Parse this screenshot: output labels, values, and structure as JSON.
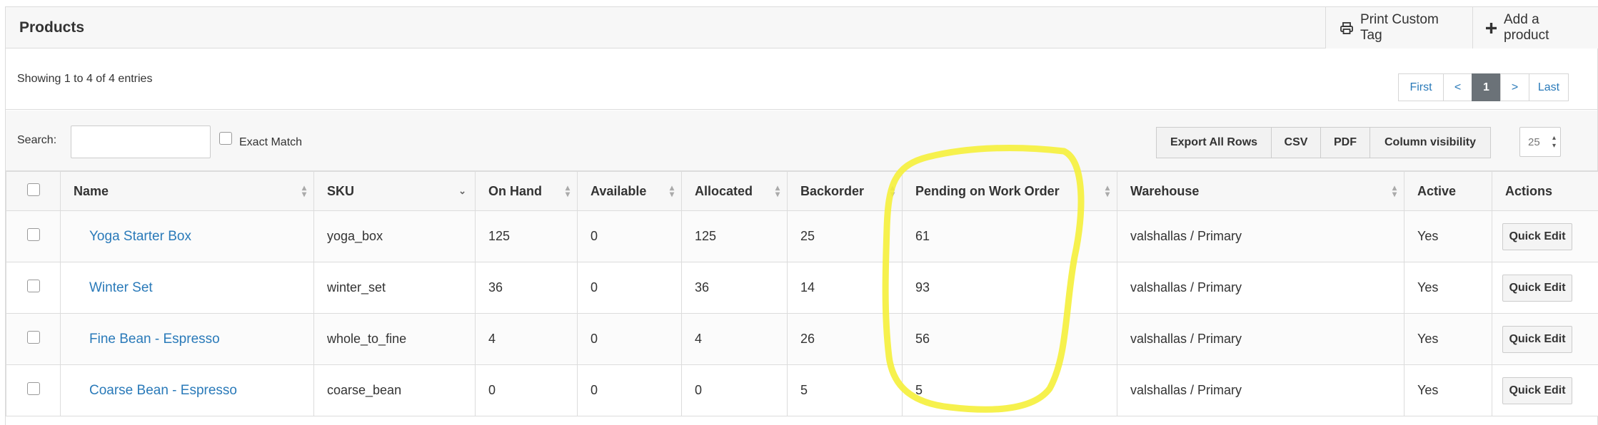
{
  "header": {
    "title": "Products",
    "print_label": "Print Custom Tag",
    "add_label": "Add a product"
  },
  "info": {
    "showing": "Showing 1 to 4 of 4 entries"
  },
  "pager": {
    "first": "First",
    "prev": "<",
    "current": "1",
    "next": ">",
    "last": "Last"
  },
  "tools": {
    "search_label": "Search:",
    "search_value": "",
    "exact_match": "Exact Match",
    "export_all": "Export All Rows",
    "csv": "CSV",
    "pdf": "PDF",
    "column_visibility": "Column visibility",
    "page_length": "25"
  },
  "table": {
    "columns": [
      "Name",
      "SKU",
      "On Hand",
      "Available",
      "Allocated",
      "Backorder",
      "Pending on Work Order",
      "Warehouse",
      "Active",
      "Actions"
    ],
    "rows": [
      {
        "name": "Yoga Starter Box",
        "sku": "yoga_box",
        "on_hand": "125",
        "available": "0",
        "allocated": "125",
        "backorder": "25",
        "pending": "61",
        "warehouse": "valshallas / Primary",
        "active": "Yes",
        "action": "Quick Edit"
      },
      {
        "name": "Winter Set",
        "sku": "winter_set",
        "on_hand": "36",
        "available": "0",
        "allocated": "36",
        "backorder": "14",
        "pending": "93",
        "warehouse": "valshallas / Primary",
        "active": "Yes",
        "action": "Quick Edit"
      },
      {
        "name": "Fine Bean - Espresso",
        "sku": "whole_to_fine",
        "on_hand": "4",
        "available": "0",
        "allocated": "4",
        "backorder": "26",
        "pending": "56",
        "warehouse": "valshallas / Primary",
        "active": "Yes",
        "action": "Quick Edit"
      },
      {
        "name": "Coarse Bean - Espresso",
        "sku": "coarse_bean",
        "on_hand": "0",
        "available": "0",
        "allocated": "0",
        "backorder": "5",
        "pending": "5",
        "warehouse": "valshallas / Primary",
        "active": "Yes",
        "action": "Quick Edit"
      }
    ]
  },
  "colors": {
    "link": "#2a7ab9",
    "highlight": "#f5ef3a"
  }
}
